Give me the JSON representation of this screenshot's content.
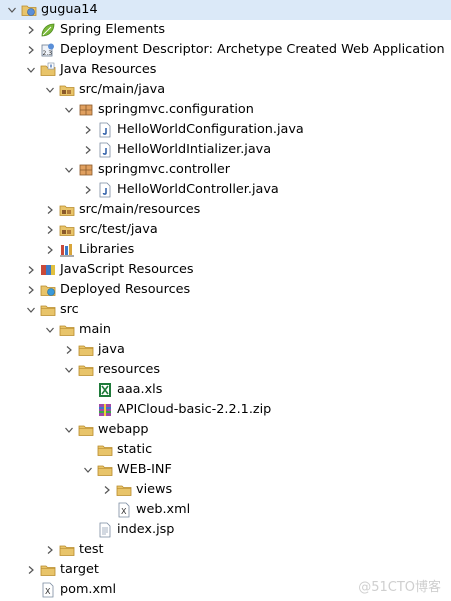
{
  "tree": [
    {
      "label": "gugua14",
      "icon": "web-project-icon",
      "depth": 0,
      "twisty": "expanded",
      "selected": true
    },
    {
      "label": "Spring Elements",
      "icon": "spring-leaf-icon",
      "depth": 1,
      "twisty": "collapsed"
    },
    {
      "label": "Deployment Descriptor: Archetype Created Web Application",
      "icon": "deployment-descriptor-icon",
      "depth": 1,
      "twisty": "collapsed"
    },
    {
      "label": "Java Resources",
      "icon": "java-resources-icon",
      "depth": 1,
      "twisty": "expanded"
    },
    {
      "label": "src/main/java",
      "icon": "source-folder-icon",
      "depth": 2,
      "twisty": "expanded"
    },
    {
      "label": "springmvc.configuration",
      "icon": "package-icon",
      "depth": 3,
      "twisty": "expanded"
    },
    {
      "label": "HelloWorldConfiguration.java",
      "icon": "java-file-icon",
      "depth": 4,
      "twisty": "collapsed"
    },
    {
      "label": "HelloWorldIntializer.java",
      "icon": "java-file-icon",
      "depth": 4,
      "twisty": "collapsed"
    },
    {
      "label": "springmvc.controller",
      "icon": "package-icon",
      "depth": 3,
      "twisty": "expanded"
    },
    {
      "label": "HelloWorldController.java",
      "icon": "java-file-icon",
      "depth": 4,
      "twisty": "collapsed"
    },
    {
      "label": "src/main/resources",
      "icon": "source-folder-icon",
      "depth": 2,
      "twisty": "collapsed"
    },
    {
      "label": "src/test/java",
      "icon": "source-folder-icon",
      "depth": 2,
      "twisty": "collapsed"
    },
    {
      "label": "Libraries",
      "icon": "libraries-icon",
      "depth": 2,
      "twisty": "collapsed"
    },
    {
      "label": "JavaScript Resources",
      "icon": "javascript-resources-icon",
      "depth": 1,
      "twisty": "collapsed"
    },
    {
      "label": "Deployed Resources",
      "icon": "deployed-resources-icon",
      "depth": 1,
      "twisty": "collapsed"
    },
    {
      "label": "src",
      "icon": "folder-icon",
      "depth": 1,
      "twisty": "expanded"
    },
    {
      "label": "main",
      "icon": "folder-icon",
      "depth": 2,
      "twisty": "expanded"
    },
    {
      "label": "java",
      "icon": "folder-icon",
      "depth": 3,
      "twisty": "collapsed"
    },
    {
      "label": "resources",
      "icon": "folder-icon",
      "depth": 3,
      "twisty": "expanded"
    },
    {
      "label": "aaa.xls",
      "icon": "excel-file-icon",
      "depth": 4,
      "twisty": "none"
    },
    {
      "label": "APICloud-basic-2.2.1.zip",
      "icon": "zip-file-icon",
      "depth": 4,
      "twisty": "none"
    },
    {
      "label": "webapp",
      "icon": "folder-icon",
      "depth": 3,
      "twisty": "expanded"
    },
    {
      "label": "static",
      "icon": "folder-icon",
      "depth": 4,
      "twisty": "none"
    },
    {
      "label": "WEB-INF",
      "icon": "folder-icon",
      "depth": 4,
      "twisty": "expanded"
    },
    {
      "label": "views",
      "icon": "folder-icon",
      "depth": 5,
      "twisty": "collapsed"
    },
    {
      "label": "web.xml",
      "icon": "xml-file-icon",
      "depth": 5,
      "twisty": "none"
    },
    {
      "label": "index.jsp",
      "icon": "jsp-file-icon",
      "depth": 4,
      "twisty": "none"
    },
    {
      "label": "test",
      "icon": "folder-icon",
      "depth": 2,
      "twisty": "collapsed"
    },
    {
      "label": "target",
      "icon": "folder-icon",
      "depth": 1,
      "twisty": "collapsed"
    },
    {
      "label": "pom.xml",
      "icon": "xml-file-icon",
      "depth": 1,
      "twisty": "none"
    }
  ],
  "watermark": "@51CTO博客",
  "colors": {
    "selection": "#dbe9f8",
    "folder": "#e8c46a",
    "folder_dark": "#b88a2a",
    "java_blue": "#2f5fa8",
    "twisty": "#555555",
    "watermark": "#cfcfcf"
  }
}
